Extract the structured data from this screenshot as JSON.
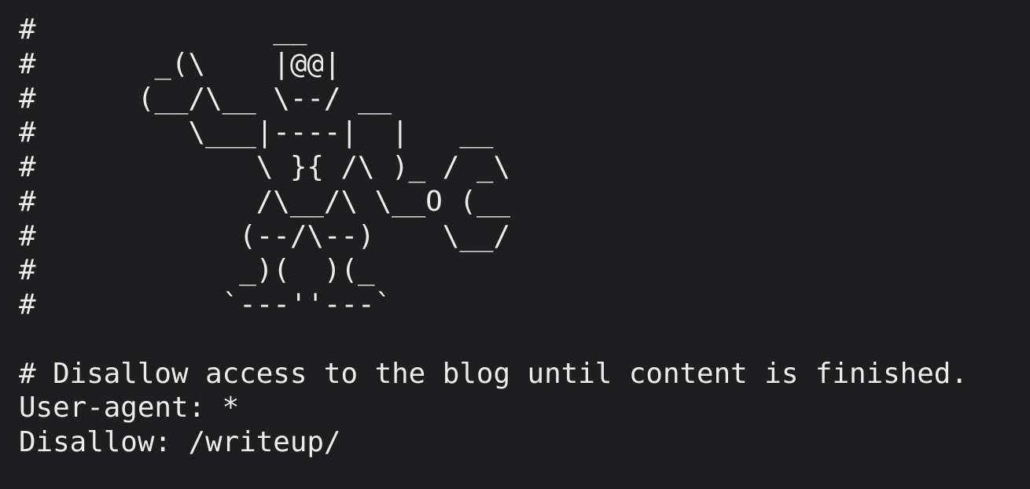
{
  "file": {
    "lines": [
      "#              __",
      "#       _(\\    |@@|",
      "#      (__/\\__ \\--/ __",
      "#         \\___|----|  |   __",
      "#             \\ }{ /\\ )_ / _\\",
      "#             /\\__/\\ \\__O (__",
      "#            (--/\\--)    \\__/",
      "#            _)(  )(_",
      "#           `---''---`",
      "",
      "# Disallow access to the blog until content is finished.",
      "User-agent: *",
      "Disallow: /writeup/"
    ]
  },
  "colors": {
    "background": "#1e1e20",
    "text": "#ececec"
  }
}
